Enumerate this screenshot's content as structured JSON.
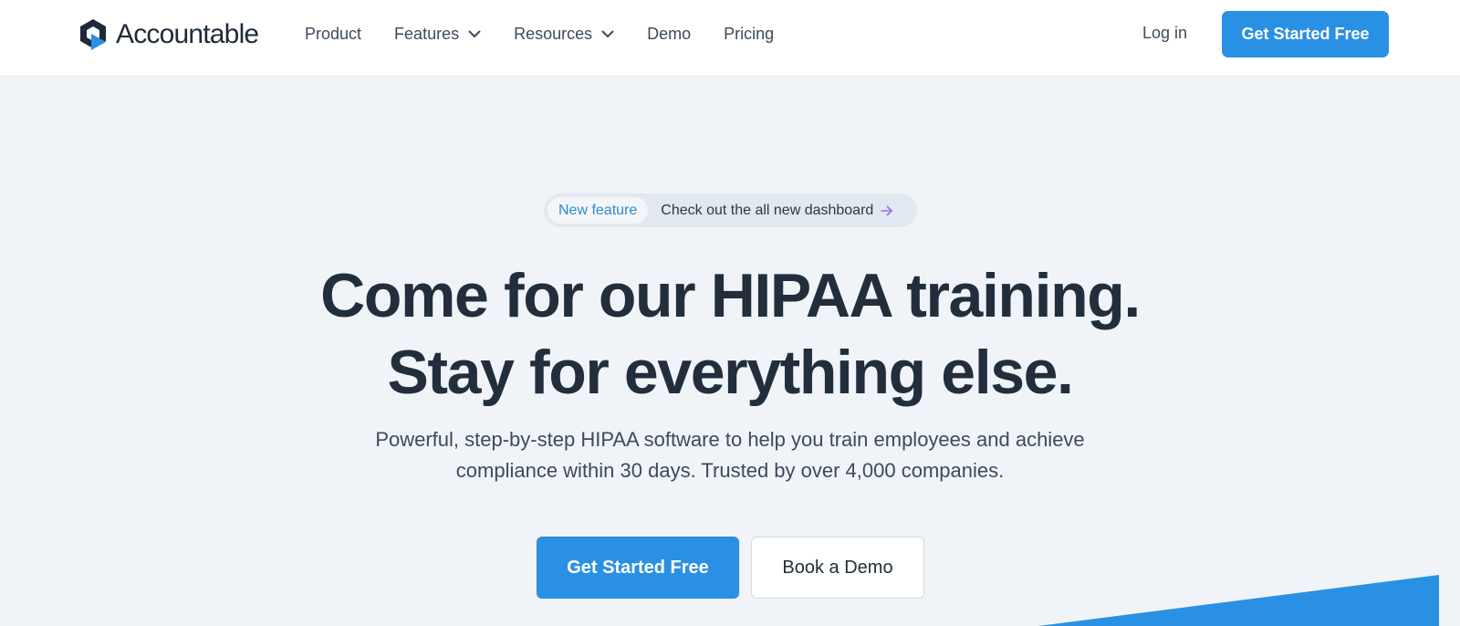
{
  "nav": {
    "brand": "Accountable",
    "links": [
      {
        "label": "Product",
        "has_dropdown": false
      },
      {
        "label": "Features",
        "has_dropdown": true
      },
      {
        "label": "Resources",
        "has_dropdown": true
      },
      {
        "label": "Demo",
        "has_dropdown": false
      },
      {
        "label": "Pricing",
        "has_dropdown": false
      }
    ],
    "login_label": "Log in",
    "cta_label": "Get Started Free"
  },
  "hero": {
    "badge_tag": "New feature",
    "badge_text": "Check out the all new dashboard",
    "badge_icon": "arrow-right-icon",
    "headline_line1": "Come for our HIPAA training.",
    "headline_line2": "Stay for everything else.",
    "subtext": "Powerful, step-by-step HIPAA software to help you train employees and achieve compliance within 30 days. Trusted by over 4,000 companies.",
    "primary_cta": "Get Started Free",
    "secondary_cta": "Book a Demo"
  },
  "colors": {
    "brand_blue": "#2a90e3",
    "logo_dark": "#1e2a3a",
    "background": "#f0f4f8",
    "badge_arrow": "#9a6cf0"
  }
}
